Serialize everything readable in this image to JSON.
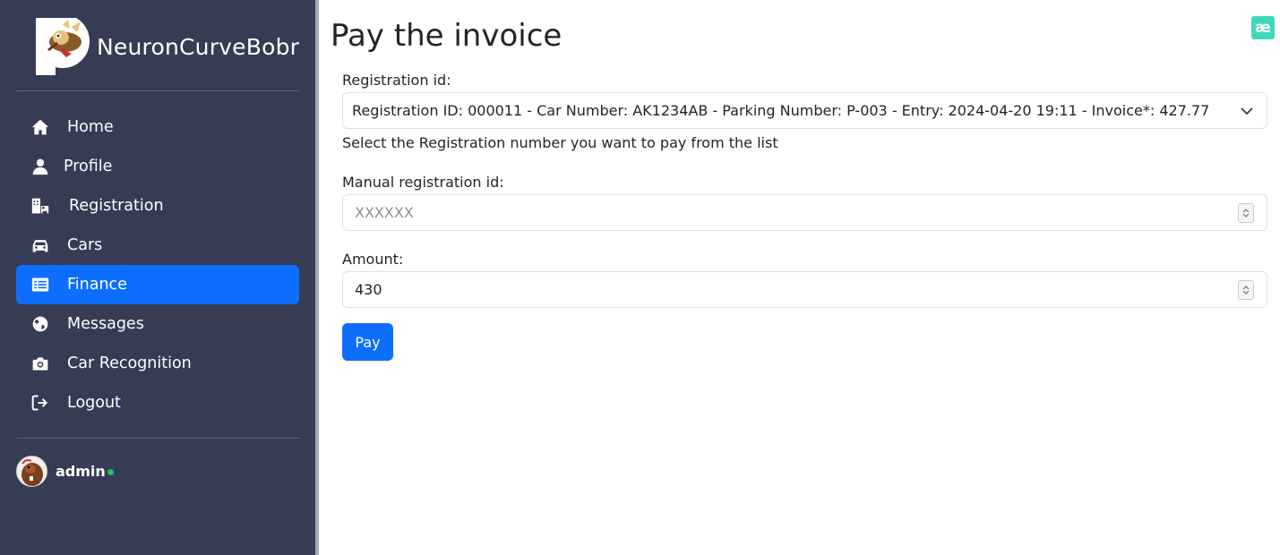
{
  "brand": {
    "name": "NeuronCurveBobr"
  },
  "nav": {
    "items": [
      {
        "label": "Home",
        "icon": "home-icon"
      },
      {
        "label": "Profile",
        "icon": "user-icon"
      },
      {
        "label": "Registration",
        "icon": "building-bed-icon"
      },
      {
        "label": "Cars",
        "icon": "car-icon"
      },
      {
        "label": "Finance",
        "icon": "list-icon",
        "active": true
      },
      {
        "label": "Messages",
        "icon": "globe-icon"
      },
      {
        "label": "Car Recognition",
        "icon": "camera-icon"
      },
      {
        "label": "Logout",
        "icon": "logout-icon"
      }
    ]
  },
  "user": {
    "name": "admin",
    "status_color": "#22c55e"
  },
  "page": {
    "title": "Pay the invoice"
  },
  "form": {
    "registration_label": "Registration id:",
    "registration_selected": "Registration ID: 000011 - Car Number: AK1234AB - Parking Number: P-003 - Entry: 2024-04-20 19:11 - Invoice*: 427.77",
    "registration_help": "Select the Registration number you want to pay from the list",
    "manual_label": "Manual registration id:",
    "manual_placeholder": "XXXXXX",
    "amount_label": "Amount:",
    "amount_value": "430",
    "pay_label": "Pay"
  },
  "colors": {
    "sidebar_bg": "#353c54",
    "accent": "#0d6efd",
    "corner_badge": "#3fd8ba"
  },
  "corner_badge": {
    "glyph": "æ"
  }
}
